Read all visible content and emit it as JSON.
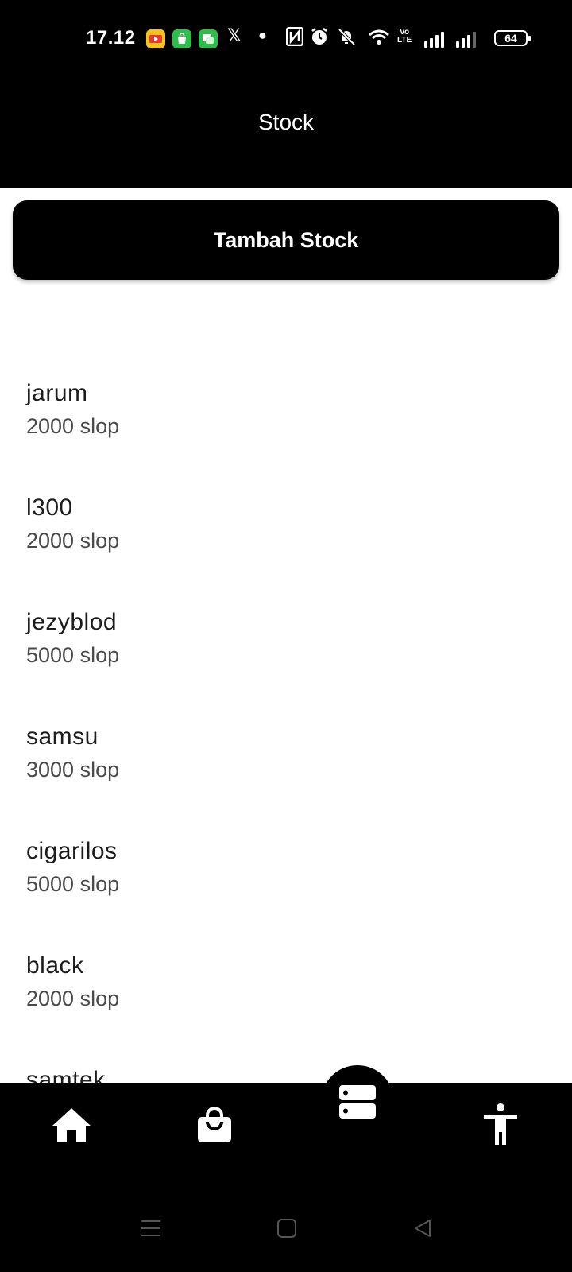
{
  "status_bar": {
    "time": "17.12",
    "battery": "64",
    "volte_line1": "Vo",
    "volte_line2": "LTE",
    "icons": [
      "yt-lite-app-icon",
      "store-app-icon",
      "messages-app-icon",
      "x-app-icon",
      "dot-icon",
      "nfc-icon",
      "alarm-icon",
      "mute-icon",
      "wifi-icon",
      "volte-icon",
      "signal-icon",
      "signal-icon",
      "battery-icon"
    ]
  },
  "app_bar": {
    "title": "Stock"
  },
  "add_button": {
    "label": "Tambah Stock"
  },
  "stock_items": [
    {
      "name": "jarum",
      "qty": "2000 slop"
    },
    {
      "name": "l300",
      "qty": "2000 slop"
    },
    {
      "name": "jezyblod",
      "qty": "5000 slop"
    },
    {
      "name": "samsu",
      "qty": "3000 slop"
    },
    {
      "name": "cigarilos",
      "qty": "5000 slop"
    },
    {
      "name": "black",
      "qty": "2000 slop"
    },
    {
      "name": "samtek",
      "qty": ""
    }
  ],
  "bottom_nav": {
    "items": [
      "home-icon",
      "shopping-bag-icon",
      "stock-storage-icon",
      "accessibility-person-icon"
    ],
    "active": "stock-storage-icon"
  },
  "system_nav": {
    "items": [
      "menu-icon",
      "home-square-icon",
      "back-triangle-icon"
    ]
  },
  "colors": {
    "primary": "#000000",
    "background": "#ffffff",
    "text_primary": "#1c1c1c",
    "text_secondary": "#4a4a4a"
  }
}
